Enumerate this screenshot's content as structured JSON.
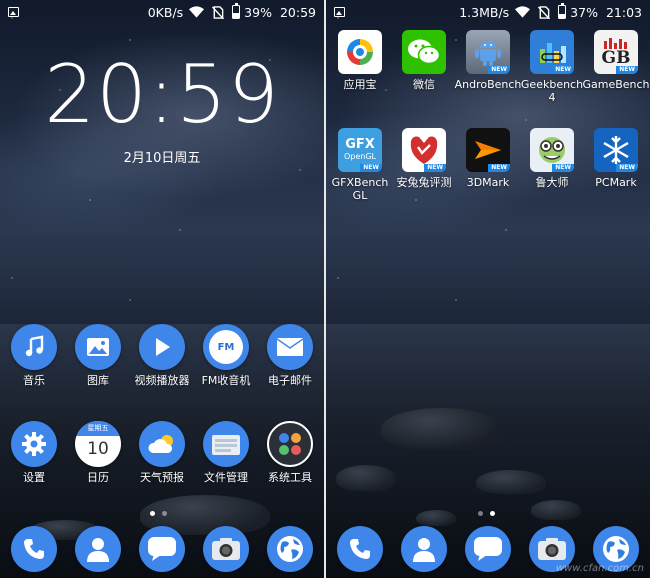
{
  "left_screen": {
    "status": {
      "net_speed": "0KB/s",
      "battery": "39%",
      "battery_level": 0.39,
      "time": "20:59"
    },
    "clock": "20:59",
    "date": "2月10日周五",
    "apps_row1": [
      {
        "label": "音乐",
        "icon": "music-note-icon"
      },
      {
        "label": "图库",
        "icon": "gallery-icon"
      },
      {
        "label": "视频播放器",
        "icon": "play-icon"
      },
      {
        "label": "FM收音机",
        "icon": "fm-radio-icon",
        "icon_text": "FM"
      },
      {
        "label": "电子邮件",
        "icon": "envelope-icon"
      }
    ],
    "apps_row2": [
      {
        "label": "设置",
        "icon": "gear-icon"
      },
      {
        "label": "日历",
        "icon": "calendar-icon",
        "weekday": "星期五",
        "day": "10"
      },
      {
        "label": "天气预报",
        "icon": "weather-icon"
      },
      {
        "label": "文件管理",
        "icon": "folder-icon"
      },
      {
        "label": "系统工具",
        "icon": "folder-grid-icon"
      }
    ]
  },
  "right_screen": {
    "status": {
      "net_speed": "1.3MB/s",
      "battery": "37%",
      "battery_level": 0.37,
      "time": "21:03"
    },
    "apps_row1": [
      {
        "label": "应用宝",
        "icon": "app-store-icon"
      },
      {
        "label": "微信",
        "icon": "wechat-icon"
      },
      {
        "label": "AndroBench",
        "icon": "android-robot-icon",
        "badge": "NEW"
      },
      {
        "label": "Geekbench 4",
        "icon": "geekbench-icon",
        "badge": "NEW"
      },
      {
        "label": "GameBench",
        "icon": "gamebench-icon",
        "icon_text": "GB",
        "badge": "NEW"
      }
    ],
    "apps_row2": [
      {
        "label": "GFXBench GL",
        "icon": "gfxbench-icon",
        "icon_text1": "GFX",
        "icon_text2": "OpenGL",
        "badge": "NEW"
      },
      {
        "label": "安兔兔评测",
        "icon": "antutu-icon",
        "badge": "NEW"
      },
      {
        "label": "3DMark",
        "icon": "3dmark-icon",
        "badge": "NEW"
      },
      {
        "label": "鲁大师",
        "icon": "ludashi-icon",
        "badge": "NEW"
      },
      {
        "label": "PCMark",
        "icon": "snowflake-icon",
        "badge": "NEW"
      }
    ]
  },
  "dock": [
    {
      "icon": "phone-icon"
    },
    {
      "icon": "contacts-icon"
    },
    {
      "icon": "message-icon"
    },
    {
      "icon": "camera-icon"
    },
    {
      "icon": "browser-globe-icon"
    }
  ],
  "watermark": "www.cfan.com.cn",
  "colors": {
    "accent_blue": "#3f86ea",
    "badge_blue": "#1e88e5"
  }
}
